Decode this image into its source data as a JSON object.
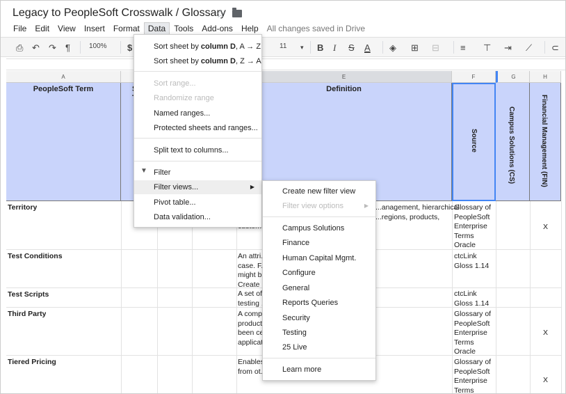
{
  "doc": {
    "title": "Legacy to PeopleSoft Crosswalk / Glossary",
    "star_icon": "☆",
    "folder_icon": "folder-icon"
  },
  "menubar": {
    "items": [
      "File",
      "Edit",
      "View",
      "Insert",
      "Format",
      "Data",
      "Tools",
      "Add-ons",
      "Help"
    ],
    "saved": "All changes saved in Drive"
  },
  "toolbar": {
    "zoom": "100%",
    "currency": "$",
    "font_size": "11"
  },
  "columns": {
    "headers": [
      "A",
      "E",
      "F",
      "G",
      "H"
    ],
    "labels": {
      "peoplesoft_term": "PeopleSoft Term",
      "partial_s": "S",
      "partial_t": "T",
      "definition": "Definition",
      "source": "Source",
      "campus": "Campus Solutions (CS)",
      "finance": "Financial Management (FIN)"
    }
  },
  "rows": [
    {
      "term": "Territory",
      "definition": [
        "...anagement, hierarchical",
        "...regions, products,",
        "custom..."
      ],
      "source": [
        "Glossary of",
        "PeopleSoft",
        "Enterprise",
        "Terms",
        "Oracle"
      ],
      "fin": "X"
    },
    {
      "term": "Test Conditions",
      "definition": [
        "An attri... that can vary in a test",
        "case.  F...te a Position, there",
        "might b...ull Time Position,",
        "Create"
      ],
      "source": [
        "ctcLink",
        "Gloss 1.14"
      ],
      "fin": ""
    },
    {
      "term": "Test Scripts",
      "definition": [
        "A set of... on the system during",
        "testing ...as expected"
      ],
      "source": [
        "ctcLink",
        "Gloss 1.14"
      ],
      "fin": ""
    },
    {
      "term": "Third Party",
      "definition": [
        "A comp...eopleSoft Enterprise",
        "product...d integrations have",
        "been ce...eopleSoft Enterprise",
        "applicat..."
      ],
      "source": [
        "Glossary of",
        "PeopleSoft",
        "Enterprise",
        "Terms",
        "Oracle"
      ],
      "fin": "X"
    },
    {
      "term": "Tiered Pricing",
      "definition": [
        "Enables ...be priced differently",
        "from ot..."
      ],
      "source": [
        "Glossary of",
        "PeopleSoft",
        "Enterprise",
        "Terms"
      ],
      "fin": "X"
    }
  ],
  "data_menu": {
    "sort_az_pre": "Sort sheet by ",
    "sort_col": "column D",
    "sort_az_post": ", A → Z",
    "sort_za_post": ", Z → A",
    "sort_range": "Sort range...",
    "randomize": "Randomize range",
    "named_ranges": "Named ranges...",
    "protected": "Protected sheets and ranges...",
    "split": "Split text to columns...",
    "filter": "Filter",
    "filter_views": "Filter views...",
    "pivot": "Pivot table...",
    "validation": "Data validation..."
  },
  "filter_submenu": {
    "create": "Create new filter view",
    "options": "Filter view options",
    "views": [
      "Campus Solutions",
      "Finance",
      "Human Capital Mgmt.",
      "Configure",
      "General",
      "Reports Queries",
      "Security",
      "Testing",
      "25 Live"
    ],
    "learn_more": "Learn more"
  }
}
